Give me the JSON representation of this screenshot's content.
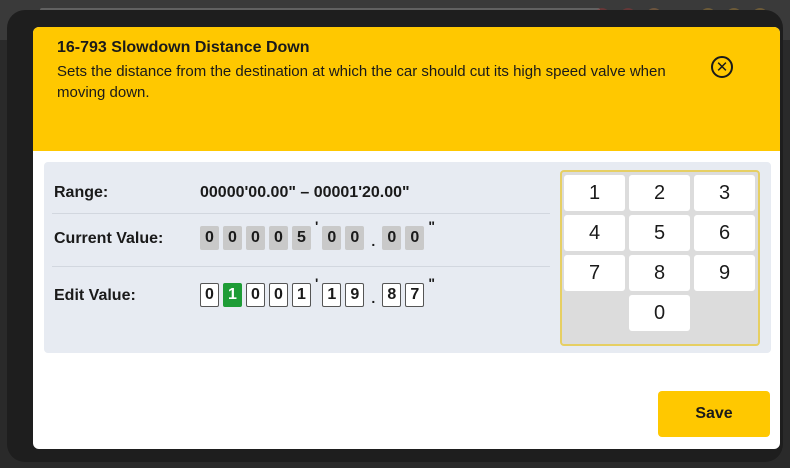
{
  "dialog": {
    "title": "16-793 Slowdown Distance Down",
    "description": "Sets the distance from the destination at which the car should cut its high speed valve when moving down.",
    "close_icon": "close-icon"
  },
  "range": {
    "label": "Range:",
    "value": "00000'00.00\"  – 00001'20.00\""
  },
  "current": {
    "label": "Current Value:",
    "digits": [
      "0",
      "0",
      "0",
      "0",
      "5",
      "0",
      "0",
      "0",
      "0"
    ]
  },
  "edit": {
    "label": "Edit Value:",
    "digits": [
      "0",
      "1",
      "0",
      "0",
      "1",
      "1",
      "9",
      "8",
      "7"
    ],
    "active_index": 1
  },
  "separators": {
    "feet": "'",
    "decimal": ".",
    "inches": "\""
  },
  "keypad": {
    "keys": [
      "1",
      "2",
      "3",
      "4",
      "5",
      "6",
      "7",
      "8",
      "9",
      "0"
    ]
  },
  "save_label": "Save",
  "colors": {
    "accent": "#ffc800",
    "active_digit": "#1e9c36"
  }
}
